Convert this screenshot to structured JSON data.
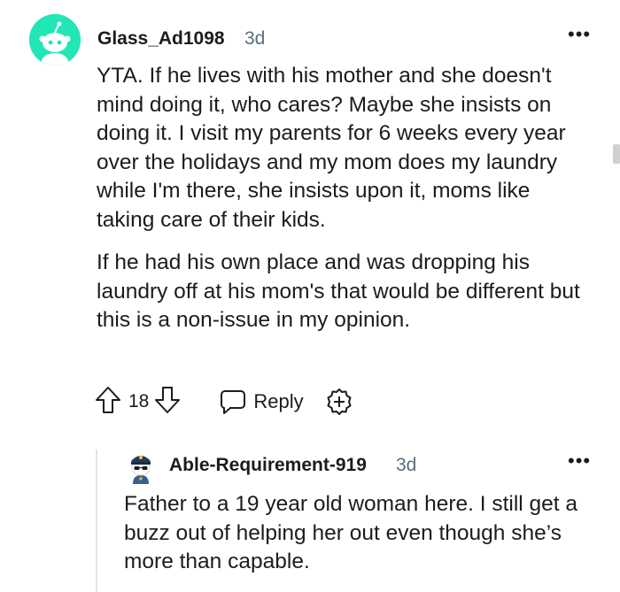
{
  "comment": {
    "username": "Glass_Ad1098",
    "time": "3d",
    "more": "•••",
    "avatar_color": "#23e6b7",
    "paragraphs": [
      "YTA. If he lives with his mother and she doesn't mind doing it, who cares? Maybe she insists on doing it. I visit my parents for 6 weeks every year over the holidays and my mom does my laundry while I'm there, she insists upon it, moms like taking care of their kids.",
      "If he had his own place and was dropping his laundry off at his mom's that would be different but this is a non-issue in my opinion."
    ],
    "actions": {
      "upvote_icon": "arrow-up-icon",
      "vote_count": "18",
      "downvote_icon": "arrow-down-icon",
      "reply_icon": "chat-bubble-icon",
      "reply_label": "Reply",
      "award_icon": "award-plus-icon"
    }
  },
  "reply": {
    "username": "Able-Requirement-919",
    "time": "3d",
    "more": "•••",
    "body": "Father to a 19 year old woman here. I still get a buzz out of helping her out even though she’s more than capable."
  }
}
